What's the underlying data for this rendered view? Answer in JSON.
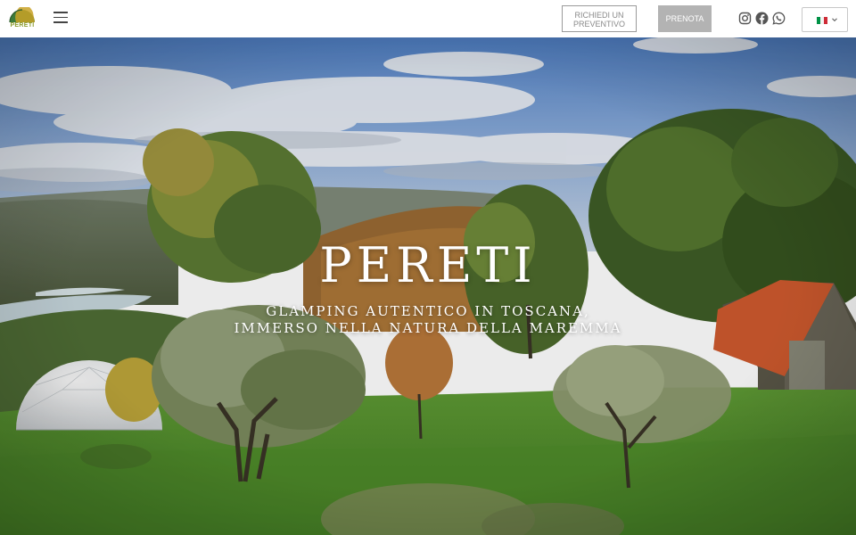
{
  "header": {
    "logo_text": "PERETI",
    "quote_button": {
      "line1": "RICHIEDI UN",
      "line2": "PREVENTIVO"
    },
    "book_button": "PRENOTA",
    "social": [
      "instagram-icon",
      "facebook-icon",
      "whatsapp-icon"
    ],
    "language": {
      "selected": "it",
      "flag_colors": [
        "#009246",
        "#ffffff",
        "#ce2b37"
      ]
    }
  },
  "hero": {
    "title": "PERETI",
    "subtitle_line1": "GLAMPING AUTENTICO IN TOSCANA,",
    "subtitle_line2": "IMMERSO NELLA NATURA DELLA MAREMMA"
  },
  "colors": {
    "accent_logo": "#8a9a2c",
    "book_button_bg": "#b3b3b3"
  }
}
